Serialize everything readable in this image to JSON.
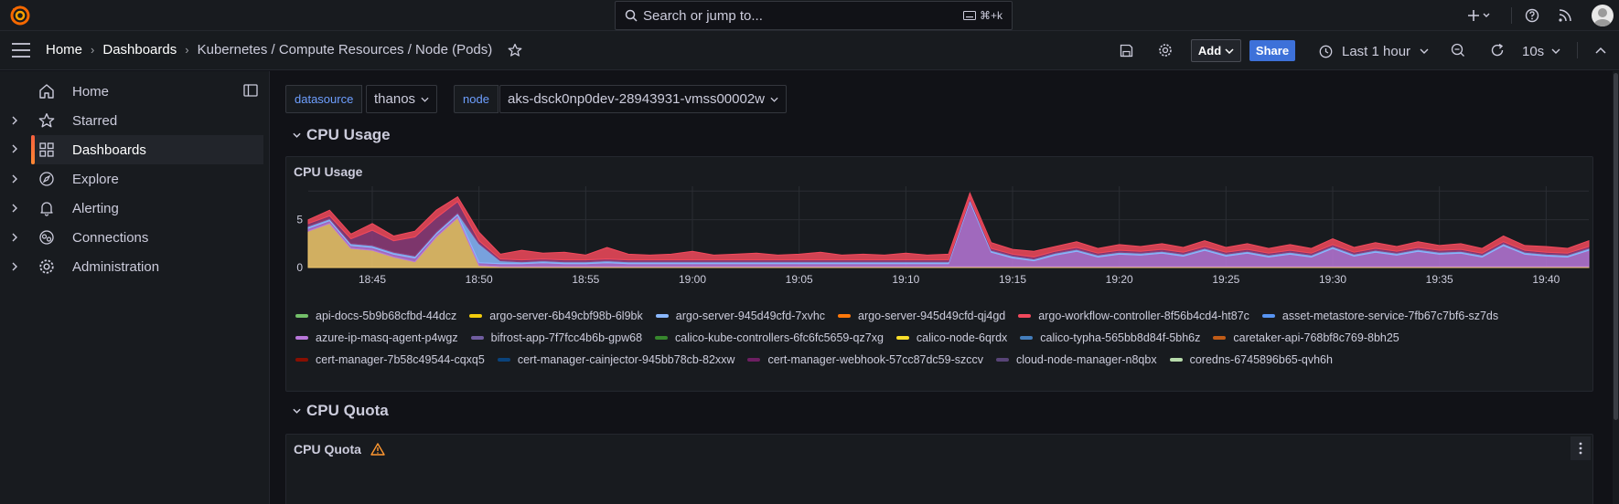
{
  "topbar": {
    "search_placeholder": "Search or jump to...",
    "search_shortcut": "⌘+k"
  },
  "breadcrumb": {
    "home": "Home",
    "dashboards": "Dashboards",
    "current": "Kubernetes / Compute Resources / Node (Pods)"
  },
  "toolbar": {
    "add_label": "Add",
    "share_label": "Share",
    "time_range": "Last 1 hour",
    "refresh_interval": "10s"
  },
  "sidebar": {
    "items": [
      {
        "label": "Home",
        "icon": "home-icon",
        "expandable": false
      },
      {
        "label": "Starred",
        "icon": "star-icon",
        "expandable": true
      },
      {
        "label": "Dashboards",
        "icon": "apps-icon",
        "expandable": true,
        "active": true
      },
      {
        "label": "Explore",
        "icon": "compass-icon",
        "expandable": true
      },
      {
        "label": "Alerting",
        "icon": "bell-icon",
        "expandable": true
      },
      {
        "label": "Connections",
        "icon": "connections-icon",
        "expandable": true
      },
      {
        "label": "Administration",
        "icon": "cog-icon",
        "expandable": true
      }
    ]
  },
  "variables": {
    "datasource_label": "datasource",
    "datasource_value": "thanos",
    "node_label": "node",
    "node_value": "aks-dsck0np0dev-28943931-vmss00002w"
  },
  "rows": {
    "cpu_usage_row": "CPU Usage",
    "cpu_quota_row": "CPU Quota"
  },
  "panels": {
    "cpu_usage_title": "CPU Usage",
    "cpu_quota_title": "CPU Quota"
  },
  "chart_data": {
    "type": "area",
    "title": "CPU Usage",
    "ylim": [
      0,
      8.5
    ],
    "yticks": [
      "0",
      "5"
    ],
    "xticks": [
      "18:45",
      "18:50",
      "18:55",
      "19:00",
      "19:05",
      "19:10",
      "19:15",
      "19:20",
      "19:25",
      "19:30",
      "19:35",
      "19:40"
    ],
    "grid": true,
    "legend_placement": "bottom",
    "x": [
      "18:42",
      "18:43",
      "18:44",
      "18:45",
      "18:46",
      "18:47",
      "18:48",
      "18:49",
      "18:50",
      "18:51",
      "18:52",
      "18:53",
      "18:54",
      "18:55",
      "18:56",
      "18:57",
      "18:58",
      "18:59",
      "19:00",
      "19:01",
      "19:02",
      "19:03",
      "19:04",
      "19:05",
      "19:06",
      "19:07",
      "19:08",
      "19:09",
      "19:10",
      "19:11",
      "19:12",
      "19:13",
      "19:14",
      "19:15",
      "19:16",
      "19:17",
      "19:18",
      "19:19",
      "19:20",
      "19:21",
      "19:22",
      "19:23",
      "19:24",
      "19:25",
      "19:26",
      "19:27",
      "19:28",
      "19:29",
      "19:30",
      "19:31",
      "19:32",
      "19:33",
      "19:34",
      "19:35",
      "19:36",
      "19:37",
      "19:38",
      "19:39",
      "19:40",
      "19:41",
      "19:42"
    ],
    "series": [
      {
        "name": "argo-server-6b49cbf98b-6l9bk",
        "color": "#f2c96d",
        "values": [
          3.8,
          4.6,
          2.0,
          1.8,
          1.1,
          0.6,
          3.2,
          5.2,
          0.2,
          0.1,
          0.1,
          0.1,
          0.1,
          0.1,
          0.1,
          0.1,
          0.1,
          0.1,
          0.1,
          0.1,
          0.1,
          0.1,
          0.1,
          0.1,
          0.1,
          0.1,
          0.1,
          0.1,
          0.1,
          0.1,
          0.1,
          0.1,
          0.1,
          0.1,
          0.1,
          0.1,
          0.1,
          0.1,
          0.1,
          0.1,
          0.1,
          0.1,
          0.1,
          0.1,
          0.1,
          0.1,
          0.1,
          0.1,
          0.1,
          0.1,
          0.1,
          0.1,
          0.1,
          0.1,
          0.1,
          0.1,
          0.1,
          0.1,
          0.1,
          0.1,
          0.1
        ]
      },
      {
        "name": "bifrost-app-7f7fcc4b6b-gpw68",
        "color": "#b877d9",
        "values": [
          0.3,
          0.3,
          0.3,
          0.3,
          0.3,
          0.4,
          0.3,
          0.3,
          0.3,
          0.3,
          0.3,
          0.4,
          0.3,
          0.3,
          0.4,
          0.3,
          0.3,
          0.3,
          0.3,
          0.3,
          0.3,
          0.3,
          0.3,
          0.3,
          0.3,
          0.3,
          0.3,
          0.3,
          0.3,
          0.3,
          0.3,
          6.8,
          1.5,
          0.9,
          0.6,
          1.2,
          1.6,
          1.0,
          1.3,
          1.2,
          1.4,
          1.1,
          1.7,
          1.1,
          1.4,
          1.0,
          1.3,
          1.0,
          1.9,
          1.1,
          1.5,
          1.2,
          1.6,
          1.3,
          1.4,
          1.0,
          2.2,
          1.3,
          1.1,
          1.0,
          1.7
        ]
      },
      {
        "name": "argo-server-945d49cfd-7xvhc",
        "color": "#8ab8ff",
        "values": [
          0.2,
          0.2,
          0.2,
          0.2,
          0.2,
          0.2,
          0.2,
          0.2,
          2.0,
          0.3,
          0.2,
          0.2,
          0.2,
          0.2,
          0.2,
          0.2,
          0.2,
          0.2,
          0.2,
          0.2,
          0.2,
          0.2,
          0.2,
          0.2,
          0.2,
          0.2,
          0.2,
          0.2,
          0.2,
          0.2,
          0.2,
          0.2,
          0.2,
          0.2,
          0.2,
          0.2,
          0.2,
          0.2,
          0.2,
          0.2,
          0.2,
          0.2,
          0.2,
          0.2,
          0.2,
          0.2,
          0.2,
          0.2,
          0.2,
          0.2,
          0.2,
          0.2,
          0.2,
          0.2,
          0.2,
          0.2,
          0.2,
          0.2,
          0.2,
          0.2,
          0.2
        ]
      },
      {
        "name": "cert-manager-webhook-57cc87dc59-szccv",
        "color": "#8f3b7a",
        "values": [
          0.3,
          0.3,
          0.5,
          1.6,
          1.2,
          2.0,
          1.5,
          1.2,
          0.3,
          0.2,
          0.2,
          0.2,
          0.2,
          0.2,
          0.2,
          0.2,
          0.2,
          0.2,
          0.2,
          0.2,
          0.2,
          0.2,
          0.2,
          0.2,
          0.2,
          0.2,
          0.2,
          0.2,
          0.2,
          0.2,
          0.2,
          0.2,
          0.2,
          0.2,
          0.2,
          0.2,
          0.2,
          0.2,
          0.2,
          0.2,
          0.2,
          0.2,
          0.2,
          0.2,
          0.2,
          0.2,
          0.2,
          0.2,
          0.2,
          0.2,
          0.2,
          0.2,
          0.2,
          0.2,
          0.2,
          0.2,
          0.2,
          0.2,
          0.2,
          0.2,
          0.2
        ]
      },
      {
        "name": "argo-workflow-controller-8f56b4cd4-ht87c",
        "color": "#f2495c",
        "values": [
          0.4,
          0.6,
          0.5,
          0.7,
          0.5,
          0.6,
          0.8,
          0.5,
          0.9,
          0.5,
          1.0,
          0.6,
          0.8,
          0.5,
          1.2,
          0.6,
          0.5,
          0.6,
          0.9,
          0.5,
          0.6,
          0.7,
          0.5,
          0.6,
          0.8,
          0.5,
          0.6,
          0.5,
          0.7,
          0.5,
          0.6,
          0.5,
          0.6,
          0.5,
          0.6,
          0.5,
          0.6,
          0.5,
          0.6,
          0.5,
          0.6,
          0.5,
          0.6,
          0.5,
          0.6,
          0.5,
          0.6,
          0.5,
          0.6,
          0.5,
          0.6,
          0.5,
          0.6,
          0.5,
          0.6,
          0.5,
          0.6,
          0.5,
          0.6,
          0.5,
          0.6
        ]
      }
    ],
    "legend": [
      {
        "name": "api-docs-5b9b68cfbd-44dcz",
        "color": "#73bf69"
      },
      {
        "name": "argo-server-6b49cbf98b-6l9bk",
        "color": "#f2cc0c"
      },
      {
        "name": "argo-server-945d49cfd-7xvhc",
        "color": "#8ab8ff"
      },
      {
        "name": "argo-server-945d49cfd-qj4gd",
        "color": "#ff780a"
      },
      {
        "name": "argo-workflow-controller-8f56b4cd4-ht87c",
        "color": "#f2495c"
      },
      {
        "name": "asset-metastore-service-7fb67c7bf6-sz7ds",
        "color": "#5794f2"
      },
      {
        "name": "azure-ip-masq-agent-p4wgz",
        "color": "#b877d9"
      },
      {
        "name": "bifrost-app-7f7fcc4b6b-gpw68",
        "color": "#705da0"
      },
      {
        "name": "calico-kube-controllers-6fc6fc5659-qz7xg",
        "color": "#37872d"
      },
      {
        "name": "calico-node-6qrdx",
        "color": "#fade2a"
      },
      {
        "name": "calico-typha-565bb8d84f-5bh6z",
        "color": "#447ebc"
      },
      {
        "name": "caretaker-api-768bf8c769-8bh25",
        "color": "#c15c17"
      },
      {
        "name": "cert-manager-7b58c49544-cqxq5",
        "color": "#890f02"
      },
      {
        "name": "cert-manager-cainjector-945bb78cb-82xxw",
        "color": "#0a437c"
      },
      {
        "name": "cert-manager-webhook-57cc87dc59-szccv",
        "color": "#6d1f62"
      },
      {
        "name": "cloud-node-manager-n8qbx",
        "color": "#584477"
      },
      {
        "name": "coredns-6745896b65-qvh6h",
        "color": "#b7dbab"
      }
    ]
  }
}
